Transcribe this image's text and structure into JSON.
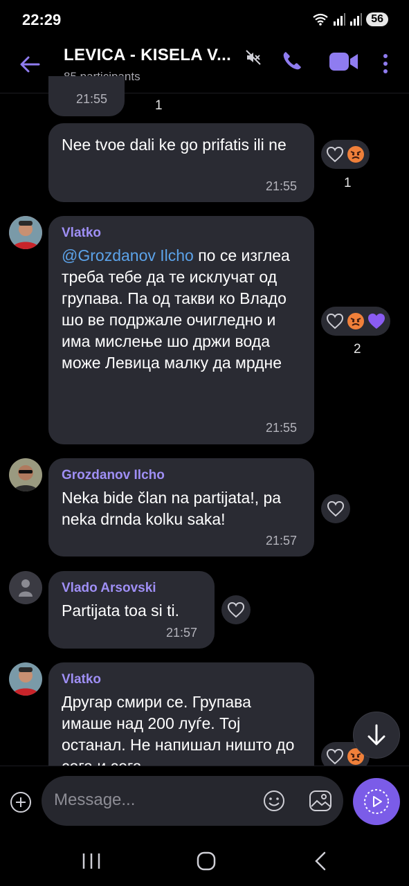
{
  "status_bar": {
    "time": "22:29",
    "battery": "56"
  },
  "header": {
    "title": "LEVICA - KISELA V...",
    "subtitle": "85 participants"
  },
  "messages": [
    {
      "time": "21:55",
      "reaction_count": "1"
    },
    {
      "text": "Nee tvoe dali ke go prifatis ili ne",
      "time": "21:55",
      "reaction_count": "1"
    },
    {
      "sender": "Vlatko",
      "mention": "@Grozdanov Ilcho",
      "text": " по се изглеа треба тебе да те исклучат од групава. Па од такви ко Владо шо ве подржале очигледно и има мислење шо држи вода може Левица малку да мрдне",
      "time": "21:55",
      "reaction_count": "2"
    },
    {
      "sender": "Grozdanov Ilcho",
      "text": "Neka bide član na partijata!, pa neka drnda kolku saka!",
      "time": "21:57"
    },
    {
      "sender": "Vlado Arsovski",
      "text": "Partijata toa si ti.",
      "time": "21:57"
    },
    {
      "sender": "Vlatko",
      "text": "Другар смири се. Групава имаше над 200 луѓе. Тој останал. Не напишал ништо до сега и сега"
    }
  ],
  "composer": {
    "placeholder": "Message..."
  },
  "colors": {
    "accent": "#7b5ce8",
    "bubble": "#2a2b33",
    "sender": "#9f8ff5",
    "mention": "#5ca3ea"
  },
  "icons": [
    "back-arrow-icon",
    "muted-speaker-icon",
    "phone-icon",
    "video-icon",
    "more-vertical-icon",
    "heart-icon",
    "angry-face-emoji",
    "purple-heart-emoji",
    "plus-icon",
    "smiley-icon",
    "sticker-icon",
    "send-icon",
    "arrow-down-icon",
    "recents-icon",
    "home-icon",
    "nav-back-icon"
  ]
}
